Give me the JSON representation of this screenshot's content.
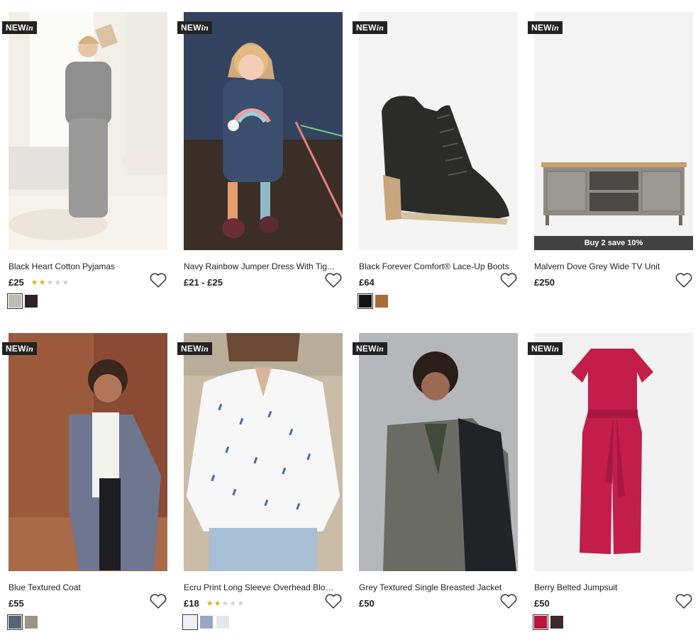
{
  "badge": {
    "new": "NEW",
    "in": "in"
  },
  "products": [
    {
      "title": "Black Heart Cotton Pyjamas",
      "price": "£25",
      "rating": 2,
      "promo": "",
      "swatches": [
        "#bdbdb8",
        "#2a2227"
      ],
      "scene": "pyjamas"
    },
    {
      "title": "Navy Rainbow Jumper Dress With Tig...",
      "price": "£21 - £25",
      "rating": 0,
      "promo": "",
      "swatches": [],
      "scene": "dress"
    },
    {
      "title": "Black Forever Comfort® Lace-Up Boots",
      "price": "£64",
      "rating": 0,
      "promo": "",
      "swatches": [
        "#141414",
        "#a86b3a"
      ],
      "scene": "boots"
    },
    {
      "title": "Malvern Dove Grey Wide TV Unit",
      "price": "£250",
      "rating": 0,
      "promo": "Buy 2 save 10%",
      "swatches": [],
      "scene": "tv"
    },
    {
      "title": "Blue Textured Coat",
      "price": "£55",
      "rating": 0,
      "promo": "",
      "swatches": [
        "#5a6478",
        "#9b9585"
      ],
      "scene": "coat"
    },
    {
      "title": "Ecru Print Long Sleeve Overhead Blouse",
      "price": "£18",
      "rating": 2,
      "promo": "",
      "swatches": [
        "#eef0f5",
        "#9aa7c4",
        "#e6e7ee"
      ],
      "scene": "blouse"
    },
    {
      "title": "Grey Textured Single Breasted Jacket",
      "price": "£50",
      "rating": 0,
      "promo": "",
      "swatches": [],
      "scene": "jacket"
    },
    {
      "title": "Berry Belted Jumpsuit",
      "price": "£50",
      "rating": 0,
      "promo": "",
      "swatches": [
        "#b8163f",
        "#3a2a2f"
      ],
      "scene": "jumpsuit"
    }
  ],
  "icons": {
    "wishlist": "heart-icon",
    "rating": "star-icon"
  }
}
